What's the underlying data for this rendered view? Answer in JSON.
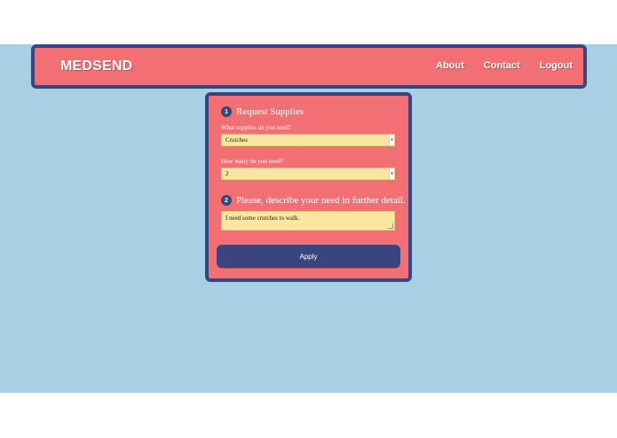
{
  "header": {
    "brand": "MEDSEND",
    "nav": [
      {
        "label": "About"
      },
      {
        "label": "Contact"
      },
      {
        "label": "Logout"
      }
    ]
  },
  "form": {
    "step1": {
      "number": "1",
      "title": "Request Supplies",
      "supplies_label": "What supplies do you need?",
      "supplies_value": "Crutches",
      "quantity_label": "How many do you need?",
      "quantity_value": "2"
    },
    "step2": {
      "number": "2",
      "title": "Please, describe your need in further detail.",
      "detail_value": "I need some crutches to walk."
    },
    "apply_label": "Apply"
  },
  "colors": {
    "background": "#a9cfe5",
    "panel": "#f27074",
    "accent": "#3a4580",
    "field": "#f9e6a0"
  }
}
